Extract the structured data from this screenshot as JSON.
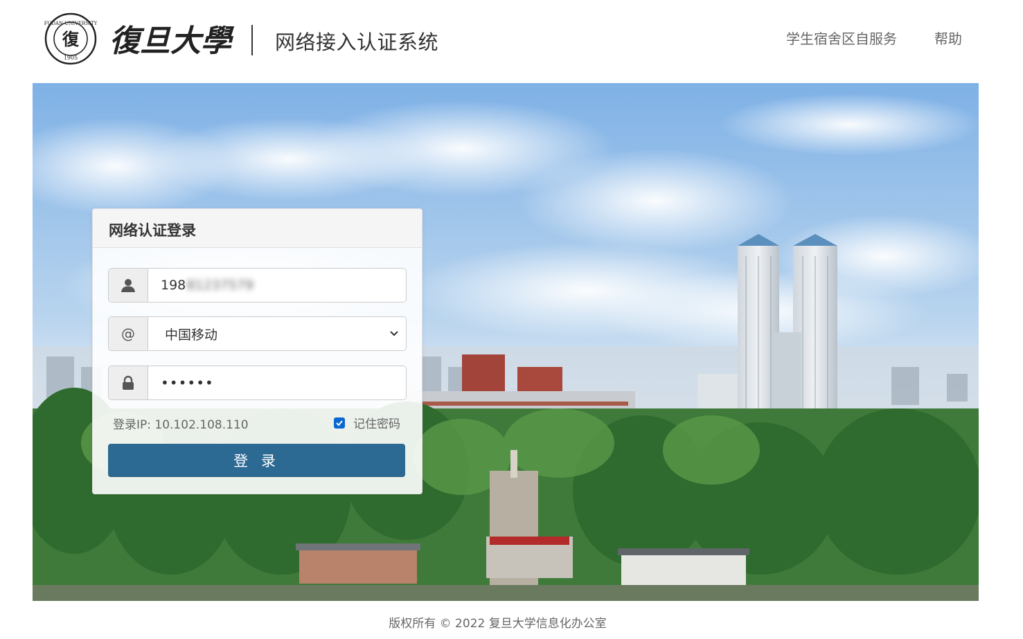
{
  "header": {
    "logo_seal_text": "FUDAN UNIVERSITY 1905",
    "logo_wordmark": "復旦大學",
    "system_title": "网络接入认证系统",
    "nav": {
      "dorm_selfservice": "学生宿舍区自服务",
      "help": "帮助"
    }
  },
  "login": {
    "title": "网络认证登录",
    "username": {
      "visible_prefix": "198",
      "blurred_suffix": "81237579",
      "icon": "user-icon"
    },
    "isp": {
      "selected": "中国移动",
      "icon": "at-sign"
    },
    "password": {
      "masked_value": "••••••",
      "icon": "lock-icon"
    },
    "ip_line": "登录IP: 10.102.108.110",
    "remember": {
      "label": "记住密码",
      "checked": true
    },
    "submit_label": "登 录"
  },
  "footer": {
    "copyright": "版权所有 © 2022 复旦大学信息化办公室"
  },
  "colors": {
    "login_button": "#2c6a93",
    "checkbox": "#0b67d0",
    "header_text": "#333333",
    "nav_text": "#666666"
  }
}
